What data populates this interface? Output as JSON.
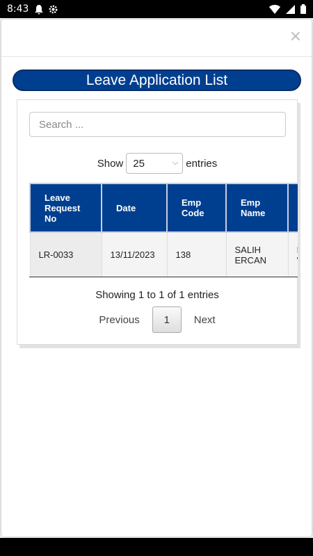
{
  "status_bar": {
    "time": "8:43"
  },
  "modal": {
    "close_label": "×"
  },
  "page": {
    "title": "Leave Application List"
  },
  "search": {
    "placeholder": "Search ..."
  },
  "length": {
    "show_label": "Show",
    "selected": "25",
    "entries_label": "entries"
  },
  "table": {
    "headers": [
      "Leave Request No",
      "Date",
      "Emp Code",
      "Emp Name",
      ""
    ],
    "rows": [
      [
        "LR-0033",
        "13/11/2023",
        "138",
        "SALIH ERCAN",
        "Ir s 'C"
      ]
    ]
  },
  "info": "Showing 1 to 1 of 1 entries",
  "pagination": {
    "previous": "Previous",
    "current": "1",
    "next": "Next"
  },
  "colors": {
    "header_blue": "#003f8f"
  }
}
